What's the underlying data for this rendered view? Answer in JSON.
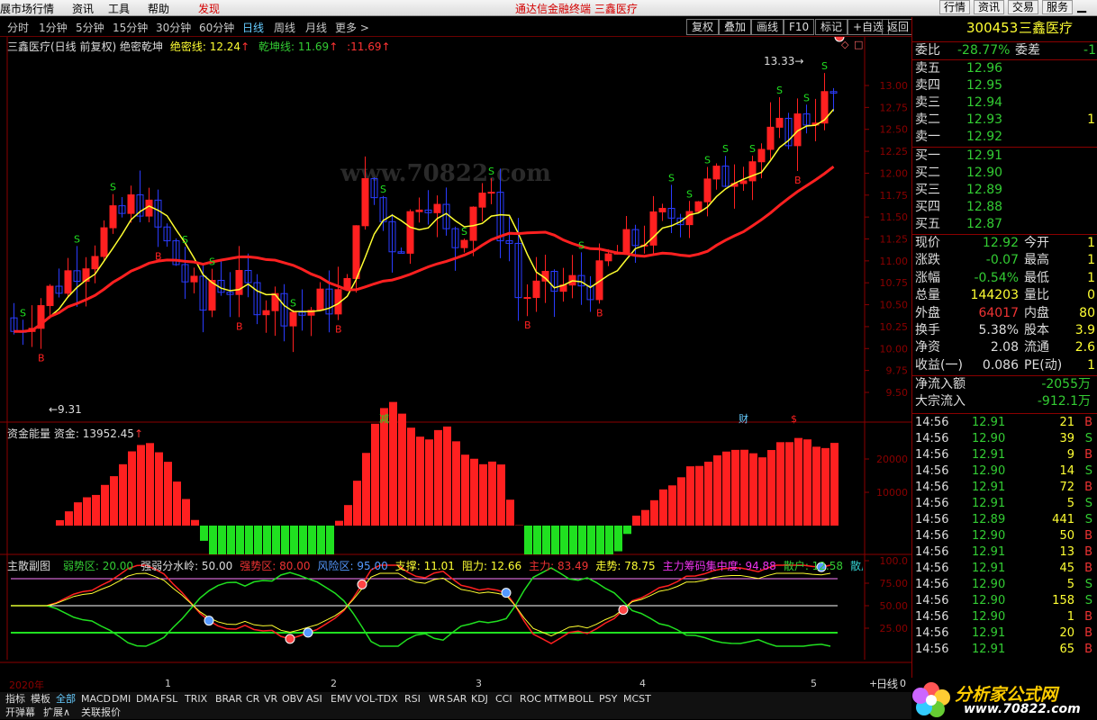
{
  "topbar": {
    "left": [
      "展市场行情",
      "资讯",
      "工具",
      "帮助"
    ],
    "discover": "发现",
    "title": "通达信金融终端 三鑫医疗",
    "right": [
      "行情",
      "资讯",
      "交易",
      "服务"
    ]
  },
  "periods": [
    "分时",
    "1分钟",
    "5分钟",
    "15分钟",
    "30分钟",
    "60分钟",
    "日线",
    "周线",
    "月线",
    "更多 >"
  ],
  "active_period": "日线",
  "tools": [
    "复权",
    "叠加",
    "画线",
    "F10",
    "标记",
    "+自选",
    "返回"
  ],
  "main_header": {
    "name": "三鑫医疗(日线 前复权) 绝密乾坤",
    "l1_label": "绝密线:",
    "l1_val": "12.24",
    "l2_label": "乾坤线:",
    "l2_val": "11.69",
    "l3_val": ":11.69"
  },
  "price_axis": [
    "13.00",
    "12.75",
    "12.50",
    "12.25",
    "12.00",
    "11.75",
    "11.50",
    "11.25",
    "11.00",
    "10.75",
    "10.50",
    "10.25",
    "10.00",
    "9.75",
    "9.50"
  ],
  "annotations": {
    "high": "13.33",
    "low": "9.31",
    "jian": "减",
    "cai": "财",
    "dollar": "$",
    "s": "S",
    "b": "B"
  },
  "volume_header": {
    "label": "资金能量 资金: ",
    "val": "13952.45"
  },
  "volume_axis": [
    "20000",
    "10000"
  ],
  "sub_header": {
    "name": "主散副图",
    "items": [
      {
        "t": "弱势区: 20.00",
        "c": "#3c3"
      },
      {
        "t": "强弱分水岭: 50.00",
        "c": "#ddd"
      },
      {
        "t": "强势区: 80.00",
        "c": "#e33"
      },
      {
        "t": "风险区: 95.00",
        "c": "#59f"
      },
      {
        "t": "支撑: 11.01",
        "c": "#ff3"
      },
      {
        "t": "阻力: 12.66",
        "c": "#ff3"
      },
      {
        "t": "主力: 83.49",
        "c": "#e33"
      },
      {
        "t": "走势: 78.75",
        "c": "#ff3"
      },
      {
        "t": "主力筹码集中度: 94.88",
        "c": "#e3e"
      },
      {
        "t": "散户: 12.58",
        "c": "#3c3"
      },
      {
        "t": "散户筹码集中",
        "c": "#3cc"
      }
    ]
  },
  "sub_axis": [
    "100.0",
    "75.00",
    "50.00",
    "25.00"
  ],
  "date_axis": {
    "year": "2020年",
    "months": [
      "1",
      "2",
      "3",
      "4",
      "5"
    ]
  },
  "bottom_tabs": [
    "指标",
    "模板",
    "全部",
    "MACD",
    "DMI",
    "DMA",
    "FSL",
    "TRIX",
    "BRAR",
    "CR",
    "VR",
    "OBV",
    "ASI",
    "EMV",
    "VOL-TDX",
    "RSI",
    "WR",
    "SAR",
    "KDJ",
    "CCI",
    "ROC",
    "MTM",
    "BOLL",
    "PSY",
    "MCST"
  ],
  "bottom_tabs2": [
    "开弹幕",
    "扩展∧",
    "关联报价"
  ],
  "bottom_right": "日线",
  "stock": {
    "code": "300453",
    "name": "三鑫医疗"
  },
  "weibi": {
    "l1": "委比",
    "v1": "-28.77%",
    "l2": "委差",
    "v2": "-1"
  },
  "sell": [
    {
      "l": "卖五",
      "p": "12.96"
    },
    {
      "l": "卖四",
      "p": "12.95"
    },
    {
      "l": "卖三",
      "p": "12.94"
    },
    {
      "l": "卖二",
      "p": "12.93",
      "v": "1"
    },
    {
      "l": "卖一",
      "p": "12.92"
    }
  ],
  "buy": [
    {
      "l": "买一",
      "p": "12.91"
    },
    {
      "l": "买二",
      "p": "12.90"
    },
    {
      "l": "买三",
      "p": "12.89"
    },
    {
      "l": "买四",
      "p": "12.88"
    },
    {
      "l": "买五",
      "p": "12.87"
    }
  ],
  "quote": [
    {
      "l1": "现价",
      "v1": "12.92",
      "c1": "#3c3",
      "l2": "今开",
      "v2": "1"
    },
    {
      "l1": "涨跌",
      "v1": "-0.07",
      "c1": "#3c3",
      "l2": "最高",
      "v2": "1"
    },
    {
      "l1": "涨幅",
      "v1": "-0.54%",
      "c1": "#3c3",
      "l2": "最低",
      "v2": "1"
    },
    {
      "l1": "总量",
      "v1": "144203",
      "c1": "#ff3",
      "l2": "量比",
      "v2": "0"
    },
    {
      "l1": "外盘",
      "v1": "64017",
      "c1": "#e33",
      "l2": "内盘",
      "v2": "80"
    },
    {
      "l1": "换手",
      "v1": "5.38%",
      "c1": "#ddd",
      "l2": "股本",
      "v2": "3.9"
    },
    {
      "l1": "净资",
      "v1": "2.08",
      "c1": "#ddd",
      "l2": "流通",
      "v2": "2.6"
    },
    {
      "l1": "收益(一)",
      "v1": "0.086",
      "c1": "#ddd",
      "l2": "PE(动)",
      "v2": "1"
    }
  ],
  "flow": [
    {
      "l": "净流入额",
      "v": "-2055万"
    },
    {
      "l": "大宗流入",
      "v": "-912.1万"
    }
  ],
  "ticks": [
    {
      "t": "14:56",
      "p": "12.91",
      "v": "21",
      "d": "B"
    },
    {
      "t": "14:56",
      "p": "12.90",
      "v": "39",
      "d": "S"
    },
    {
      "t": "14:56",
      "p": "12.91",
      "v": "9",
      "d": "B"
    },
    {
      "t": "14:56",
      "p": "12.90",
      "v": "14",
      "d": "S"
    },
    {
      "t": "14:56",
      "p": "12.91",
      "v": "72",
      "d": "B"
    },
    {
      "t": "14:56",
      "p": "12.91",
      "v": "5",
      "d": "S"
    },
    {
      "t": "14:56",
      "p": "12.89",
      "v": "441",
      "d": "S"
    },
    {
      "t": "14:56",
      "p": "12.90",
      "v": "50",
      "d": "B"
    },
    {
      "t": "14:56",
      "p": "12.91",
      "v": "13",
      "d": "B"
    },
    {
      "t": "14:56",
      "p": "12.91",
      "v": "45",
      "d": "B"
    },
    {
      "t": "14:56",
      "p": "12.90",
      "v": "5",
      "d": "S"
    },
    {
      "t": "14:56",
      "p": "12.90",
      "v": "158",
      "d": "S"
    },
    {
      "t": "14:56",
      "p": "12.90",
      "v": "1",
      "d": "B"
    },
    {
      "t": "14:56",
      "p": "12.91",
      "v": "20",
      "d": "B"
    },
    {
      "t": "14:56",
      "p": "12.91",
      "v": "65",
      "d": "B"
    }
  ],
  "logo": {
    "title": "分析家公式网",
    "url": "www.70822.com"
  },
  "watermark": "www.70822.com",
  "colors": {
    "up": "#ff2020",
    "down": "#2a3cff",
    "yellow": "#ffff30",
    "green": "#20e020",
    "magenta": "#ff20ff",
    "bg": "#000000"
  }
}
